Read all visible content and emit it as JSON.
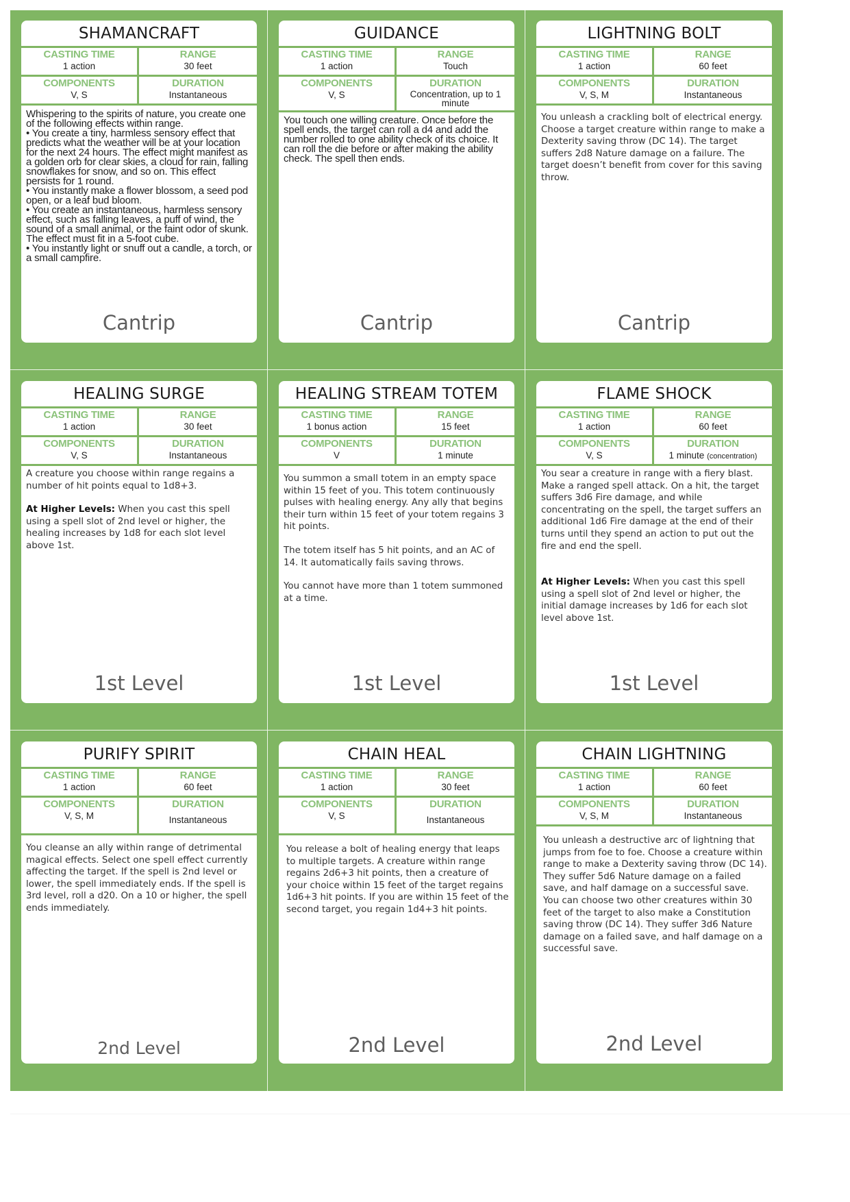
{
  "colors": {
    "panel_green": "#80b663",
    "label_green": "#8bc27a",
    "card_white": "#ffffff",
    "level_grey": "#5e5e5e"
  },
  "labels": {
    "casting_time": "CASTING TIME",
    "range": "RANGE",
    "components": "COMPONENTS",
    "duration": "DURATION"
  },
  "cards": [
    {
      "title": "SHAMANCRAFT",
      "casting_time": "1 action",
      "range": "30 feet",
      "components": "V, S",
      "duration": "Instantaneous",
      "body": [
        "Whispering to the spirits of nature, you create one of the following effects within range.",
        "• You create a tiny, harmless sensory effect that predicts what the weather will be at your location for the next 24 hours. The effect might manifest as a golden orb for clear skies, a cloud for rain, falling snowflakes for snow, and so on. This effect persists for 1 round.",
        "• You instantly make a flower blossom, a seed pod open, or a leaf bud bloom.",
        "• You create an instantaneous, harmless sensory effect, such as falling leaves, a puff of wind, the sound of a small animal, or the faint odor of skunk. The effect must fit in a 5-foot cube.",
        "• You instantly light or snuff out a candle, a torch, or a small campfire."
      ],
      "level": "Cantrip"
    },
    {
      "title": "GUIDANCE",
      "casting_time": "1 action",
      "range": "Touch",
      "components": "V, S",
      "duration": "Concentration, up to 1 minute",
      "body": [
        "You touch one willing creature. Once before the spell ends, the target can roll a d4 and add the number rolled to one ability check of its choice. It can roll the die before or after making the ability check. The spell then ends."
      ],
      "level": "Cantrip"
    },
    {
      "title": "LIGHTNING BOLT",
      "casting_time": "1 action",
      "range": "60 feet",
      "components": "V, S, M",
      "duration": "Instantaneous",
      "body": [
        "You unleash a crackling bolt of electrical energy. Choose a target creature within range to make a Dexterity saving throw (DC 14). The target suffers 2d8 Nature damage on a failure. The target doesn’t benefit from cover for this saving throw."
      ],
      "level": "Cantrip"
    },
    {
      "title": "HEALING SURGE",
      "casting_time": "1 action",
      "range": "30 feet",
      "components": "V, S",
      "duration": "Instantaneous",
      "body": [
        "A creature you choose within range regains a number of hit points equal to 1d8+3."
      ],
      "higher_levels_label": "At Higher Levels:",
      "higher_levels": "When you cast this spell using a spell slot of 2nd level or higher, the healing increases by 1d8 for each slot level above 1st.",
      "level": "1st Level"
    },
    {
      "title": "HEALING STREAM TOTEM",
      "casting_time": "1 bonus action",
      "range": "15 feet",
      "components": "V",
      "duration": "1 minute",
      "body": [
        "You summon a small totem in an empty space within 15 feet of you. This totem continuously pulses with healing energy. Any ally that begins their turn within 15 feet of your totem regains 3 hit points.",
        "The totem itself has 5 hit points, and an AC of 14. It automatically fails saving throws.",
        "You cannot have more than 1 totem summoned at a time."
      ],
      "level": "1st Level"
    },
    {
      "title": "FLAME SHOCK",
      "casting_time": "1 action",
      "range": "60 feet",
      "components": "V, S",
      "duration": "1 minute",
      "duration_note": "(concentration)",
      "body": [
        "You sear a creature in range with a fiery blast. Make a ranged spell attack. On a hit, the target suffers 3d6 Fire damage, and while concentrating on the spell, the target suffers an additional 1d6 Fire damage at the end of their turns until they spend an action to put out the fire and end the spell."
      ],
      "higher_levels_label": "At Higher Levels:",
      "higher_levels": "When you cast this spell using a spell slot of 2nd level or higher, the initial damage increases by 1d6 for each slot level above 1st.",
      "level": "1st Level"
    },
    {
      "title": "PURIFY SPIRIT",
      "casting_time": "1 action",
      "range": "60 feet",
      "components": "V, S, M",
      "duration": "Instantaneous",
      "body": [
        "You cleanse an ally within range of detrimental magical effects. Select one spell effect currently affecting the target. If the spell is 2nd level or lower, the spell immediately ends. If the spell is 3rd level, roll a d20. On a 10 or higher, the spell ends immediately."
      ],
      "level": "2nd Level"
    },
    {
      "title": "CHAIN HEAL",
      "casting_time": "1 action",
      "range": "30 feet",
      "components": "V, S",
      "duration": "Instantaneous",
      "body": [
        "You release a bolt of healing energy that leaps to multiple targets. A creature within range regains 2d6+3 hit points, then a creature of your choice within 15 feet of the target regains 1d6+3 hit points. If you are within 15 feet of the second target, you regain 1d4+3 hit points."
      ],
      "level": "2nd Level"
    },
    {
      "title": "CHAIN LIGHTNING",
      "casting_time": "1 action",
      "range": "60 feet",
      "components": "V, S, M",
      "duration": "Instantaneous",
      "body": [
        "You unleash a destructive arc of lightning that jumps from foe to foe. Choose a creature within range to make a Dexterity saving throw (DC 14). They suffer 5d6 Nature damage on a failed save, and half damage on a successful save. You can choose two other creatures within 30 feet of the target to also make a Constitution saving throw (DC 14). They suffer 3d6 Nature damage on a failed save, and half damage on a successful save."
      ],
      "level": "2nd Level"
    }
  ]
}
